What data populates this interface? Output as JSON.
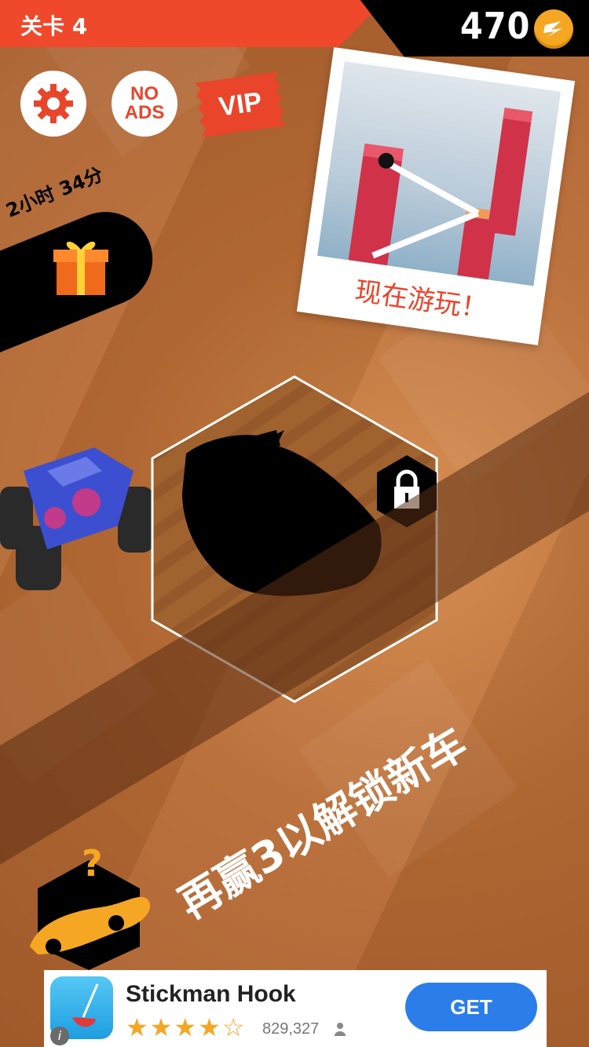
{
  "header": {
    "level_label": "关卡 4",
    "coins": "470"
  },
  "buttons": {
    "settings_icon": "gear-icon",
    "no_ads_line1": "NO",
    "no_ads_line2": "ADS",
    "vip_label": "VIP"
  },
  "gift": {
    "timer_text": "2小时 34分"
  },
  "promo": {
    "cta": "现在游玩！"
  },
  "unlock": {
    "message": "再赢3以解锁新车"
  },
  "ad_banner": {
    "app_name": "Stickman Hook",
    "stars": "★★★★☆",
    "rating_count": "829,327",
    "get_label": "GET",
    "info_label": "i"
  },
  "colors": {
    "accent_red": "#f0482a",
    "coin_gold": "#f5a623",
    "background": "#b86a34",
    "get_blue": "#2b7de9"
  }
}
